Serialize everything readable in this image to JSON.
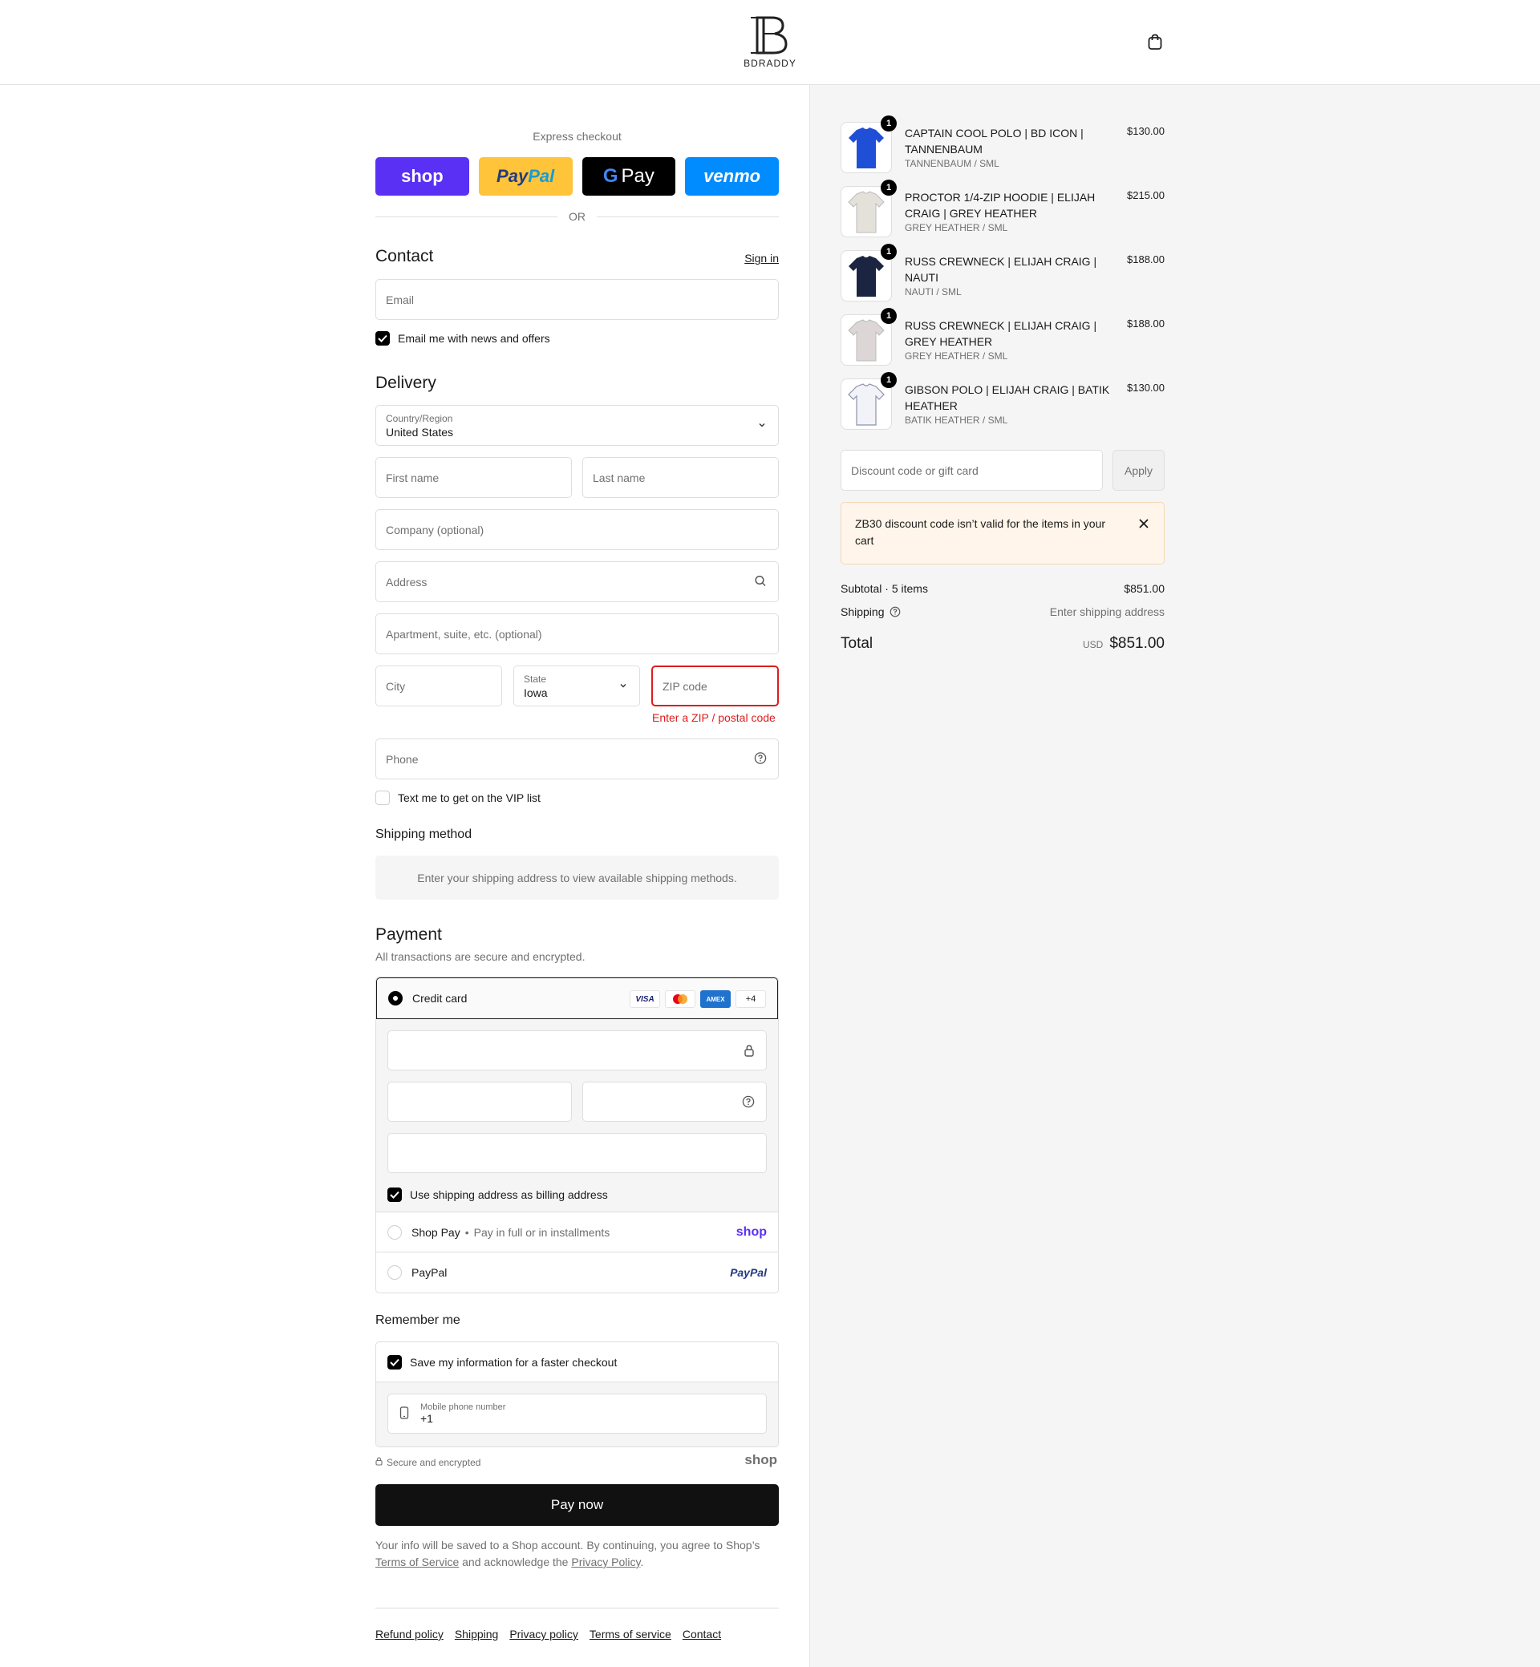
{
  "brand": {
    "logo_text": "BDRADDY",
    "accent": "#000000",
    "error": "#dd1d1d"
  },
  "express": {
    "label": "Express checkout",
    "buttons": [
      {
        "label": "shop",
        "color": "#5a31f4"
      },
      {
        "label_a": "Pay",
        "label_b": "Pal",
        "color": "#ffc439"
      },
      {
        "label": "Pay",
        "color": "#000000"
      },
      {
        "label": "venmo",
        "color": "#008cff"
      }
    ],
    "or": "OR"
  },
  "contact": {
    "title": "Contact",
    "sign_in": "Sign in",
    "email_placeholder": "Email",
    "news_label": "Email me with news and offers",
    "news_checked": true
  },
  "delivery": {
    "title": "Delivery",
    "country_label": "Country/Region",
    "country_value": "United States",
    "first_name": "First name",
    "last_name": "Last name",
    "company": "Company (optional)",
    "address": "Address",
    "apartment": "Apartment, suite, etc. (optional)",
    "city": "City",
    "state_label": "State",
    "state_value": "Iowa",
    "zip": "ZIP code",
    "zip_error": "Enter a ZIP / postal code",
    "phone": "Phone",
    "vip_label": "Text me to get on the VIP list",
    "vip_checked": false
  },
  "shipping_method": {
    "title": "Shipping method",
    "message": "Enter your shipping address to view available shipping methods."
  },
  "payment": {
    "title": "Payment",
    "subtitle": "All transactions are secure and encrypted.",
    "credit_card": "Credit card",
    "card_logos": [
      "VISA",
      "",
      "AMEX",
      "+4"
    ],
    "billing_label": "Use shipping address as billing address",
    "shop_pay": "Shop Pay",
    "shop_pay_sub": "Pay in full or in installments",
    "shop_pay_brand": "shop",
    "paypal": "PayPal",
    "paypal_brand": "PayPal"
  },
  "remember": {
    "title": "Remember me",
    "save_label": "Save my information for a faster checkout",
    "phone_label": "Mobile phone number",
    "phone_value": "+1"
  },
  "secure": {
    "label": "Secure and encrypted",
    "brand": "shop"
  },
  "pay_now": "Pay now",
  "legal": {
    "text1": "Your info will be saved to a Shop account. By continuing, you agree to Shop’s",
    "tos": "Terms of Service",
    "text2": "and acknowledge the",
    "privacy": "Privacy Policy",
    "text3": "."
  },
  "footer": [
    "Refund policy",
    "Shipping",
    "Privacy policy",
    "Terms of service",
    "Contact"
  ],
  "cart": {
    "items": [
      {
        "name": "CAPTAIN COOL POLO | BD ICON | TANNENBAUM",
        "variant": "TANNENBAUM / SML",
        "price": "$130.00",
        "qty": "1",
        "color": "#1f4fd6"
      },
      {
        "name": "PROCTOR 1/4-ZIP HOODIE | ELIJAH CRAIG | GREY HEATHER",
        "variant": "GREY HEATHER / SML",
        "price": "$215.00",
        "qty": "1",
        "color": "#e4e1da"
      },
      {
        "name": "RUSS CREWNECK | ELIJAH CRAIG | NAUTI",
        "variant": "NAUTI / SML",
        "price": "$188.00",
        "qty": "1",
        "color": "#1b2440"
      },
      {
        "name": "RUSS CREWNECK | ELIJAH CRAIG | GREY HEATHER",
        "variant": "GREY HEATHER / SML",
        "price": "$188.00",
        "qty": "1",
        "color": "#dcd6d6"
      },
      {
        "name": "GIBSON POLO | ELIJAH CRAIG | BATIK HEATHER",
        "variant": "BATIK HEATHER / SML",
        "price": "$130.00",
        "qty": "1",
        "color": "#f2f3f8"
      }
    ],
    "discount_placeholder": "Discount code or gift card",
    "apply": "Apply",
    "alert": "ZB30 discount code isn’t valid for the items in your cart",
    "subtotal_label": "Subtotal · 5 items",
    "subtotal_value": "$851.00",
    "shipping_label": "Shipping",
    "shipping_value": "Enter shipping address",
    "total_label": "Total",
    "currency": "USD",
    "total_value": "$851.00"
  }
}
